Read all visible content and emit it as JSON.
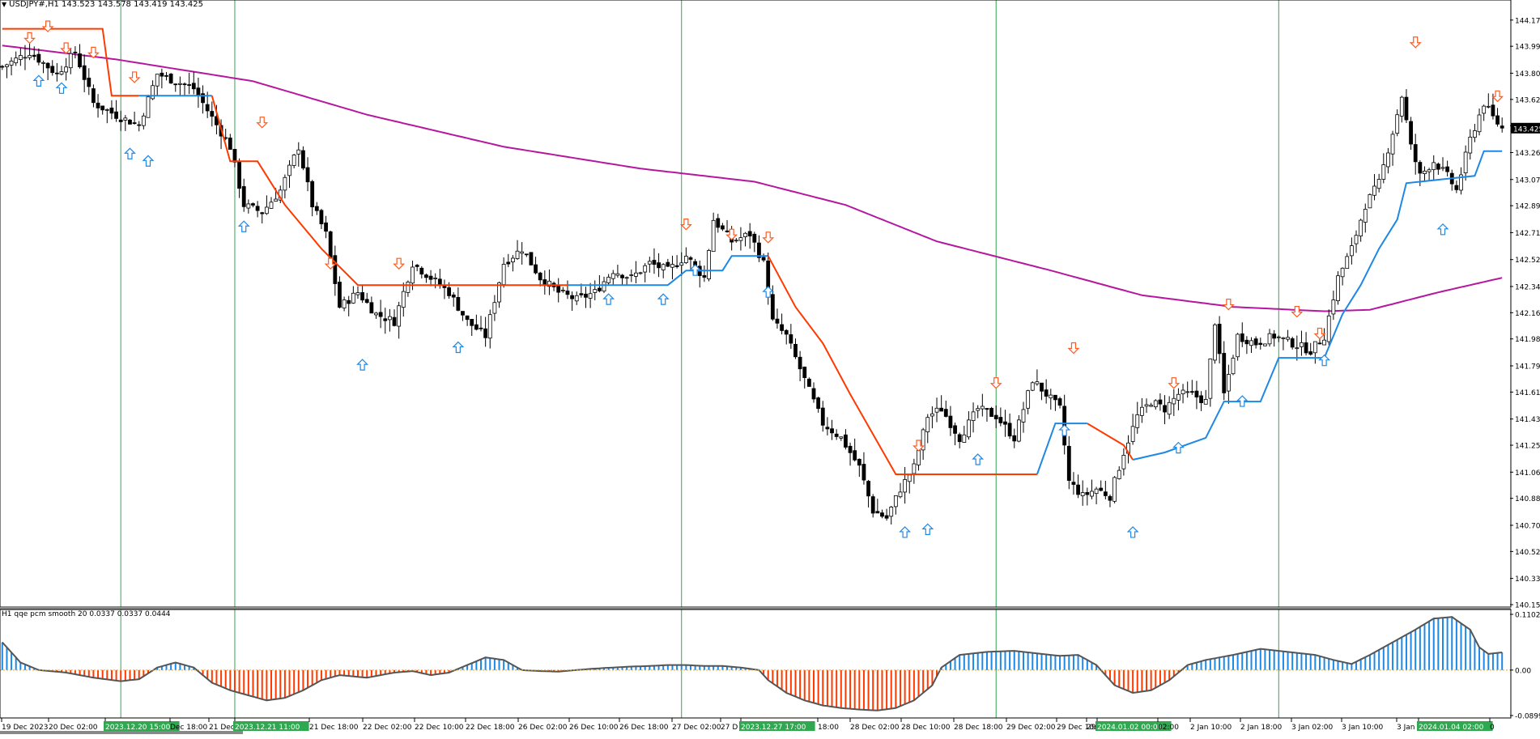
{
  "header": {
    "symbol_timeframe": "USDJPY#,H1",
    "ohlc": "143.523 143.578 143.419 143.425"
  },
  "indicator": {
    "label": "H1  qqe pcm smooth  20 0.0337 0.0337 0.0444"
  },
  "current_price_label": "143.425",
  "colors": {
    "up_candle": "#ffffff",
    "down_candle": "#000000",
    "ma_line": "#b5179e",
    "trail_down": "#ff3a00",
    "trail_up": "#1e88e5",
    "signal_up": "#1e88e5",
    "signal_down": "#ff5a1f",
    "hist_pos": "#1e88e5",
    "hist_neg": "#ff3a00",
    "vline": "#2fa84f",
    "time_highlight": "#2fa84f"
  },
  "chart_data": [
    {
      "type": "candlestick",
      "symbol": "USDJPY#",
      "timeframe": "H1",
      "y_ticks": [
        144.17,
        143.99,
        143.805,
        143.625,
        143.445,
        143.26,
        143.075,
        142.895,
        142.71,
        142.525,
        142.34,
        142.16,
        141.98,
        141.795,
        141.615,
        141.43,
        141.25,
        141.065,
        140.885,
        140.7,
        140.52,
        140.335,
        140.155
      ],
      "y_tick_labels": [
        "144.170",
        "143.990",
        "143.805",
        "143.625",
        "143.445",
        "143.260",
        "143.075",
        "142.895",
        "142.710",
        "142.525",
        "142.340",
        "142.160",
        "141.980",
        "141.795",
        "141.615",
        "141.430",
        "141.250",
        "141.065",
        "140.885",
        "140.700",
        "140.520",
        "140.335",
        "140.155"
      ],
      "ylim": [
        140.155,
        144.23
      ],
      "last_price": 143.425,
      "x_labels": [
        "19 Dec 2023",
        "20 Dec 02:00",
        "2023.12.20 15:00",
        "Dec 18:00",
        "21 Dec",
        "2023.12.21 11:00",
        "21 Dec 18:00",
        "22 Dec 02:00",
        "22 Dec 10:00",
        "22 Dec 18:00",
        "26 Dec 02:00",
        "26 Dec 10:00",
        "26 Dec 18:00",
        "27 Dec 02:00",
        "27 D",
        "2023.12.27 17:00",
        "18:00",
        "28 Dec 02:00",
        "28 Dec 10:00",
        "28 Dec 18:00",
        "29 Dec 02:00",
        "29 Dec 10:00",
        "29",
        "2024.01.02 00:00",
        "02:00",
        "2 Jan 10:00",
        "2 Jan 18:00",
        "3 Jan 02:00",
        "3 Jan 10:00",
        "3 Jan",
        "2024.01.04 02:00",
        "0"
      ],
      "highlighted_times": [
        "2023.12.20 15:00",
        "2023.12.21 11:00",
        "2023.12.27 17:00",
        "2024.01.02 00:00",
        "2024.01.04 02:00"
      ],
      "close_path": [
        [
          0,
          143.85
        ],
        [
          6,
          143.95
        ],
        [
          12,
          143.8
        ],
        [
          16,
          143.95
        ],
        [
          20,
          143.6
        ],
        [
          26,
          143.5
        ],
        [
          30,
          143.45
        ],
        [
          34,
          143.8
        ],
        [
          38,
          143.75
        ],
        [
          42,
          143.7
        ],
        [
          46,
          143.5
        ],
        [
          50,
          143.3
        ],
        [
          53,
          142.9
        ],
        [
          57,
          142.85
        ],
        [
          61,
          143.0
        ],
        [
          65,
          143.3
        ],
        [
          68,
          142.9
        ],
        [
          71,
          142.7
        ],
        [
          74,
          142.2
        ],
        [
          78,
          142.3
        ],
        [
          82,
          142.15
        ],
        [
          86,
          142.1
        ],
        [
          90,
          142.5
        ],
        [
          94,
          142.4
        ],
        [
          98,
          142.3
        ],
        [
          102,
          142.1
        ],
        [
          106,
          142.0
        ],
        [
          110,
          142.5
        ],
        [
          114,
          142.6
        ],
        [
          118,
          142.4
        ],
        [
          122,
          142.3
        ],
        [
          126,
          142.25
        ],
        [
          130,
          142.3
        ],
        [
          134,
          142.45
        ],
        [
          138,
          142.4
        ],
        [
          142,
          142.5
        ],
        [
          146,
          142.45
        ],
        [
          150,
          142.55
        ],
        [
          154,
          142.4
        ],
        [
          156,
          142.8
        ],
        [
          160,
          142.65
        ],
        [
          164,
          142.7
        ],
        [
          167,
          142.5
        ],
        [
          169,
          142.1
        ],
        [
          172,
          142.0
        ],
        [
          176,
          141.7
        ],
        [
          180,
          141.4
        ],
        [
          184,
          141.3
        ],
        [
          188,
          141.1
        ],
        [
          191,
          140.8
        ],
        [
          194,
          140.75
        ],
        [
          197,
          140.95
        ],
        [
          200,
          141.1
        ],
        [
          203,
          141.45
        ],
        [
          206,
          141.5
        ],
        [
          210,
          141.3
        ],
        [
          214,
          141.5
        ],
        [
          218,
          141.45
        ],
        [
          222,
          141.3
        ],
        [
          226,
          141.7
        ],
        [
          229,
          141.6
        ],
        [
          232,
          141.5
        ],
        [
          234,
          141.0
        ],
        [
          237,
          140.9
        ],
        [
          240,
          140.95
        ],
        [
          243,
          140.9
        ],
        [
          246,
          141.2
        ],
        [
          249,
          141.45
        ],
        [
          252,
          141.55
        ],
        [
          255,
          141.5
        ],
        [
          258,
          141.6
        ],
        [
          261,
          141.6
        ],
        [
          264,
          141.55
        ],
        [
          266,
          142.1
        ],
        [
          268,
          141.6
        ],
        [
          271,
          142.0
        ],
        [
          275,
          141.95
        ],
        [
          279,
          142.0
        ],
        [
          283,
          141.95
        ],
        [
          287,
          141.9
        ],
        [
          290,
          142.0
        ],
        [
          293,
          142.4
        ],
        [
          296,
          142.6
        ],
        [
          299,
          142.9
        ],
        [
          302,
          143.05
        ],
        [
          305,
          143.4
        ],
        [
          307,
          143.65
        ],
        [
          309,
          143.3
        ],
        [
          311,
          143.1
        ],
        [
          314,
          143.2
        ],
        [
          317,
          143.1
        ],
        [
          319,
          143.0
        ],
        [
          322,
          143.35
        ],
        [
          325,
          143.6
        ],
        [
          327,
          143.5
        ],
        [
          329,
          143.425
        ]
      ],
      "moving_average": [
        [
          0,
          143.995
        ],
        [
          25,
          143.9
        ],
        [
          55,
          143.75
        ],
        [
          80,
          143.52
        ],
        [
          110,
          143.3
        ],
        [
          140,
          143.15
        ],
        [
          165,
          143.06
        ],
        [
          185,
          142.9
        ],
        [
          205,
          142.65
        ],
        [
          230,
          142.45
        ],
        [
          250,
          142.28
        ],
        [
          270,
          142.2
        ],
        [
          290,
          142.17
        ],
        [
          300,
          142.18
        ],
        [
          315,
          142.3
        ],
        [
          329,
          142.4
        ]
      ],
      "trail_stop_segments": [
        {
          "trend": "down",
          "points": [
            [
              0,
              144.11
            ],
            [
              22,
              144.11
            ],
            [
              24,
              143.65
            ],
            [
              30,
              143.65
            ]
          ]
        },
        {
          "trend": "up",
          "points": [
            [
              30,
              143.65
            ],
            [
              46,
              143.65
            ]
          ]
        },
        {
          "trend": "down",
          "points": [
            [
              46,
              143.65
            ],
            [
              50,
              143.2
            ],
            [
              56,
              143.2
            ],
            [
              62,
              142.9
            ],
            [
              70,
              142.6
            ],
            [
              78,
              142.35
            ],
            [
              124,
              142.35
            ]
          ]
        },
        {
          "trend": "up",
          "points": [
            [
              124,
              142.35
            ],
            [
              146,
              142.35
            ],
            [
              150,
              142.45
            ],
            [
              158,
              142.45
            ],
            [
              160,
              142.55
            ],
            [
              168,
              142.55
            ]
          ]
        },
        {
          "trend": "down",
          "points": [
            [
              168,
              142.55
            ],
            [
              174,
              142.2
            ],
            [
              180,
              141.95
            ],
            [
              186,
              141.6
            ],
            [
              196,
              141.05
            ],
            [
              227,
              141.05
            ]
          ]
        },
        {
          "trend": "up",
          "points": [
            [
              227,
              141.05
            ],
            [
              231,
              141.4
            ],
            [
              238,
              141.4
            ]
          ]
        },
        {
          "trend": "down",
          "points": [
            [
              238,
              141.4
            ],
            [
              246,
              141.25
            ],
            [
              248,
              141.15
            ]
          ]
        },
        {
          "trend": "up",
          "points": [
            [
              248,
              141.15
            ],
            [
              255,
              141.2
            ],
            [
              264,
              141.3
            ],
            [
              268,
              141.55
            ],
            [
              276,
              141.55
            ],
            [
              280,
              141.85
            ],
            [
              290,
              141.85
            ],
            [
              294,
              142.15
            ],
            [
              298,
              142.35
            ],
            [
              302,
              142.6
            ],
            [
              306,
              142.8
            ],
            [
              308,
              143.05
            ],
            [
              323,
              143.1
            ],
            [
              325,
              143.27
            ],
            [
              329,
              143.27
            ]
          ]
        }
      ],
      "signals_up": [
        [
          8,
          143.75
        ],
        [
          13,
          143.7
        ],
        [
          28,
          143.25
        ],
        [
          32,
          143.2
        ],
        [
          53,
          142.75
        ],
        [
          79,
          141.8
        ],
        [
          100,
          141.92
        ],
        [
          133,
          142.25
        ],
        [
          145,
          142.25
        ],
        [
          152,
          142.45
        ],
        [
          168,
          142.3
        ],
        [
          198,
          140.65
        ],
        [
          203,
          140.67
        ],
        [
          214,
          141.15
        ],
        [
          233,
          141.35
        ],
        [
          248,
          140.65
        ],
        [
          258,
          141.23
        ],
        [
          272,
          141.55
        ],
        [
          290,
          141.83
        ],
        [
          316,
          142.73
        ]
      ],
      "signals_down": [
        [
          6,
          144.05
        ],
        [
          10,
          144.13
        ],
        [
          14,
          143.98
        ],
        [
          20,
          143.95
        ],
        [
          29,
          143.78
        ],
        [
          57,
          143.47
        ],
        [
          72,
          142.5
        ],
        [
          87,
          142.5
        ],
        [
          150,
          142.77
        ],
        [
          160,
          142.7
        ],
        [
          168,
          142.68
        ],
        [
          201,
          141.25
        ],
        [
          218,
          141.68
        ],
        [
          235,
          141.92
        ],
        [
          257,
          141.68
        ],
        [
          269,
          142.22
        ],
        [
          284,
          142.17
        ],
        [
          289,
          142.02
        ],
        [
          310,
          144.02
        ],
        [
          328,
          143.65
        ]
      ]
    },
    {
      "type": "histogram",
      "name": "qqe pcm smooth",
      "params": [
        20,
        0.0337,
        0.0337,
        0.0444
      ],
      "y_ticks": [
        0.1102,
        0.0,
        -0.0899
      ],
      "y_tick_labels": [
        "0.1102",
        "0.00",
        "-0.0899"
      ],
      "ylim": [
        -0.0899,
        0.1102
      ],
      "points": [
        [
          0,
          0.055
        ],
        [
          4,
          0.015
        ],
        [
          8,
          0.0
        ],
        [
          14,
          -0.005
        ],
        [
          20,
          -0.015
        ],
        [
          26,
          -0.022
        ],
        [
          30,
          -0.018
        ],
        [
          34,
          0.005
        ],
        [
          38,
          0.015
        ],
        [
          42,
          0.005
        ],
        [
          46,
          -0.025
        ],
        [
          50,
          -0.04
        ],
        [
          54,
          -0.05
        ],
        [
          58,
          -0.06
        ],
        [
          62,
          -0.055
        ],
        [
          66,
          -0.04
        ],
        [
          70,
          -0.02
        ],
        [
          74,
          -0.01
        ],
        [
          80,
          -0.015
        ],
        [
          86,
          -0.005
        ],
        [
          90,
          -0.002
        ],
        [
          94,
          -0.01
        ],
        [
          98,
          -0.005
        ],
        [
          102,
          0.01
        ],
        [
          106,
          0.025
        ],
        [
          110,
          0.02
        ],
        [
          114,
          0.0
        ],
        [
          118,
          -0.002
        ],
        [
          122,
          -0.003
        ],
        [
          126,
          0.0
        ],
        [
          130,
          0.003
        ],
        [
          134,
          0.005
        ],
        [
          138,
          0.007
        ],
        [
          142,
          0.008
        ],
        [
          146,
          0.01
        ],
        [
          150,
          0.01
        ],
        [
          154,
          0.008
        ],
        [
          158,
          0.008
        ],
        [
          162,
          0.005
        ],
        [
          166,
          0.0
        ],
        [
          168,
          -0.02
        ],
        [
          172,
          -0.045
        ],
        [
          176,
          -0.06
        ],
        [
          180,
          -0.07
        ],
        [
          184,
          -0.075
        ],
        [
          188,
          -0.078
        ],
        [
          192,
          -0.08
        ],
        [
          196,
          -0.075
        ],
        [
          200,
          -0.06
        ],
        [
          204,
          -0.03
        ],
        [
          206,
          0.005
        ],
        [
          210,
          0.03
        ],
        [
          216,
          0.036
        ],
        [
          222,
          0.038
        ],
        [
          228,
          0.032
        ],
        [
          232,
          0.028
        ],
        [
          236,
          0.03
        ],
        [
          240,
          0.01
        ],
        [
          244,
          -0.03
        ],
        [
          248,
          -0.045
        ],
        [
          252,
          -0.04
        ],
        [
          256,
          -0.02
        ],
        [
          260,
          0.01
        ],
        [
          264,
          0.02
        ],
        [
          270,
          0.03
        ],
        [
          276,
          0.042
        ],
        [
          282,
          0.036
        ],
        [
          288,
          0.03
        ],
        [
          292,
          0.02
        ],
        [
          296,
          0.012
        ],
        [
          300,
          0.03
        ],
        [
          306,
          0.06
        ],
        [
          310,
          0.08
        ],
        [
          314,
          0.102
        ],
        [
          318,
          0.105
        ],
        [
          322,
          0.08
        ],
        [
          324,
          0.045
        ],
        [
          326,
          0.032
        ],
        [
          329,
          0.035
        ]
      ]
    }
  ]
}
